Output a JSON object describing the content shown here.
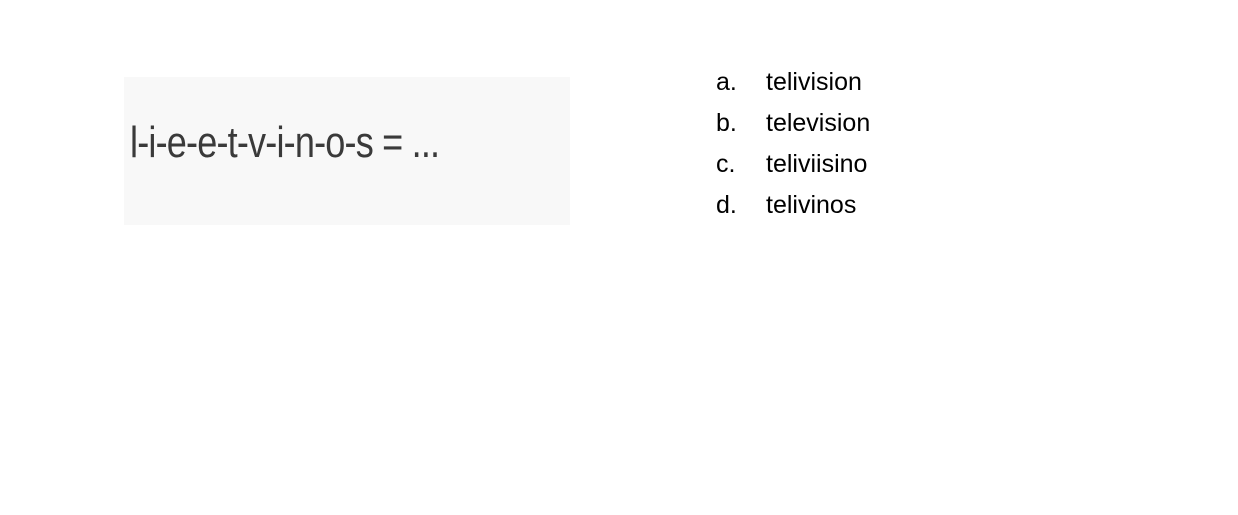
{
  "question": {
    "puzzle": "l-i-e-e-t-v-i-n-o-s = ..."
  },
  "options": [
    {
      "letter": "a.",
      "text": "telivision"
    },
    {
      "letter": "b.",
      "text": "television"
    },
    {
      "letter": "c.",
      "text": "teliviisino"
    },
    {
      "letter": "d.",
      "text": "telivinos"
    }
  ],
  "colors": {
    "puzzle_background": "#f8f8f8",
    "puzzle_text": "#3a3a3a",
    "option_text": "#000000"
  }
}
